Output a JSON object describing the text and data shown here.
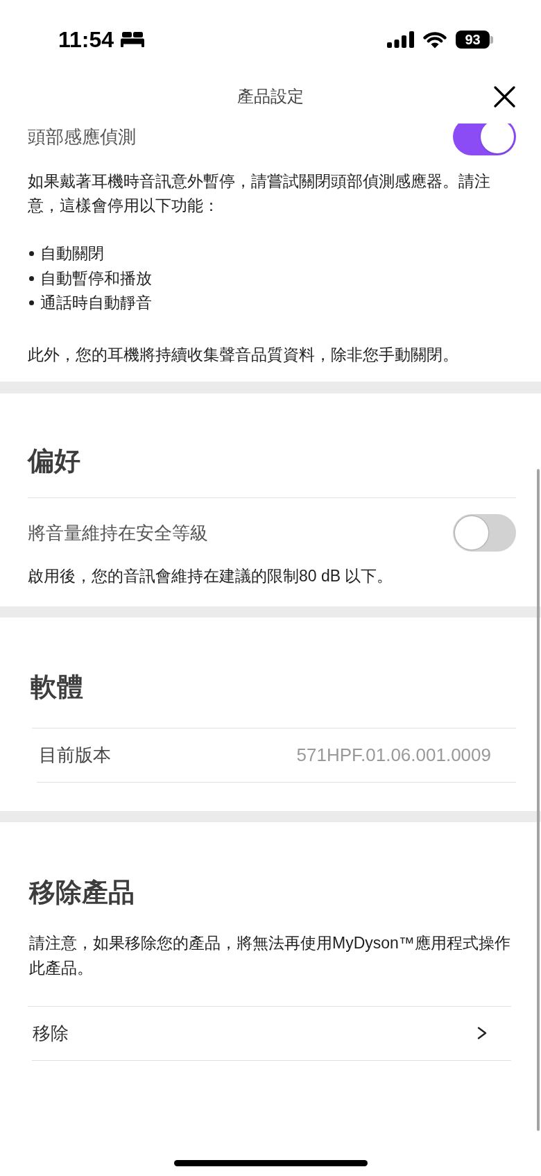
{
  "status_bar": {
    "time": "11:54",
    "battery": "93"
  },
  "header": {
    "title": "產品設定"
  },
  "head_detection": {
    "label": "頭部感應偵測",
    "on": true,
    "intro": "如果戴著耳機時音訊意外暫停，請嘗試關閉頭部偵測感應器。請注意，這樣會停用以下功能：",
    "features": [
      "自動關閉",
      "自動暫停和播放",
      "通話時自動靜音"
    ],
    "note": "此外，您的耳機將持續收集聲音品質資料，除非您手動關閉。"
  },
  "preferences": {
    "title": "偏好",
    "setting": {
      "label": "將音量維持在安全等級",
      "on": false
    },
    "note": "啟用後，您的音訊會維持在建議的限制80 dB 以下。"
  },
  "software": {
    "title": "軟體",
    "rows": [
      {
        "label": "目前版本",
        "value": "571HPF.01.06.001.0009"
      }
    ]
  },
  "remove_product": {
    "title": "移除產品",
    "note": "請注意，如果移除您的產品，將無法再使用MyDyson™應用程式操作此產品。",
    "action": "移除"
  }
}
